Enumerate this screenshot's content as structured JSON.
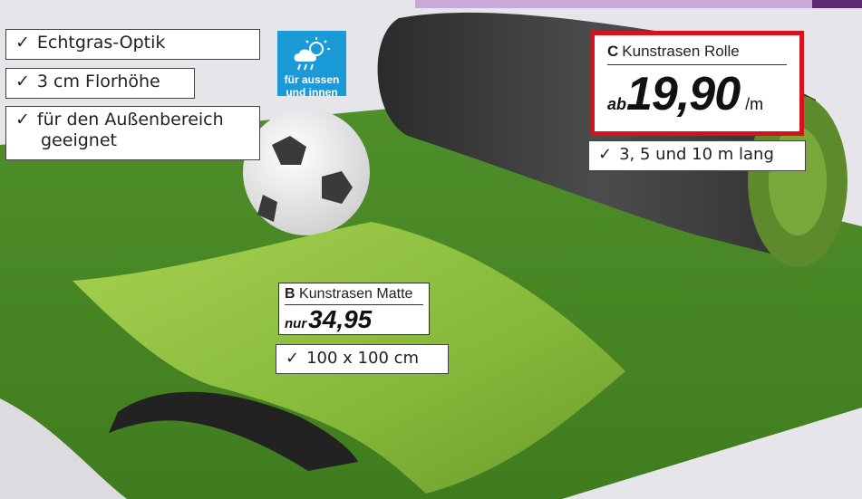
{
  "colors": {
    "grass_light": "#8fc23c",
    "grass_dark": "#3f7a1f",
    "roll": "#3b3d3c",
    "sale_red": "#d7121f",
    "badge_blue": "#1a9ad6",
    "accent_purple": "#5e2b72"
  },
  "features": {
    "item_1": "Echtgras-Optik",
    "item_2": "3 cm Florhöhe",
    "item_3_line1": "für den Außenbereich",
    "item_3_line2": "geeignet",
    "check_glyph": "✓"
  },
  "badge": {
    "icon": "sun-cloud-rain-icon",
    "line1": "für aussen",
    "line2": "und innen"
  },
  "product_c": {
    "letter": "C",
    "name": "Kunstrasen Rolle",
    "prefix": "ab",
    "price": "19,90",
    "unit": "/m",
    "note": "3, 5 und 10 m lang"
  },
  "product_b": {
    "letter": "B",
    "name": "Kunstrasen Matte",
    "prefix": "nur",
    "price": "34,95",
    "note": "100 x 100 cm"
  }
}
